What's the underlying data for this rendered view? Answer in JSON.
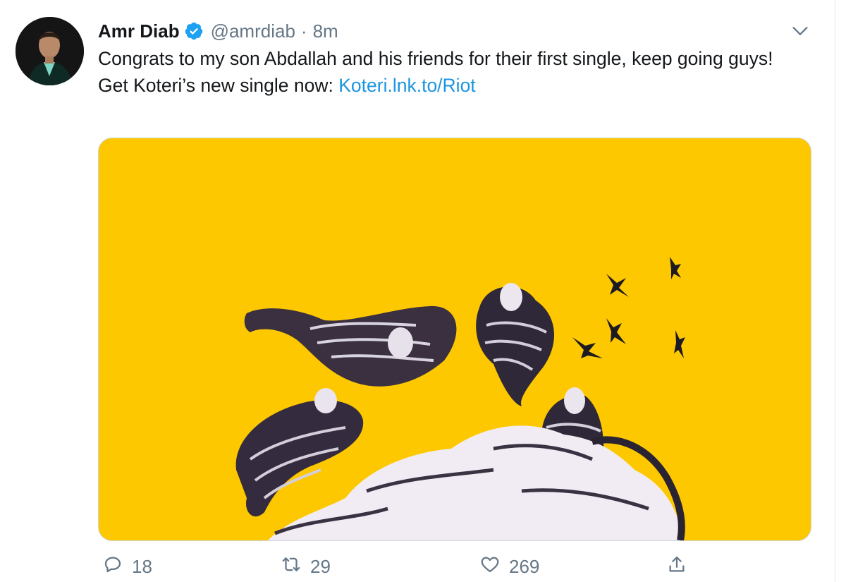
{
  "tweet": {
    "author_name": "Amr Diab",
    "handle": "@amrdiab",
    "separator": "·",
    "time": "8m",
    "text_line1": "Congrats to my son Abdallah and his friends for their first single, keep going guys!",
    "text_line2_prefix": "Get Koteri’s new single now: ",
    "link_text": "Koteri.lnk.to/Riot",
    "media_background": "#fdc800",
    "link_color": "#1b95e0",
    "verified_color": "#1da1f2"
  },
  "actions": {
    "reply_icon": "reply-icon",
    "reply_count": "18",
    "retweet_icon": "retweet-icon",
    "retweet_count": "29",
    "like_icon": "heart-icon",
    "like_count": "269",
    "share_icon": "share-icon"
  },
  "menu": {
    "icon": "chevron-down-icon"
  }
}
